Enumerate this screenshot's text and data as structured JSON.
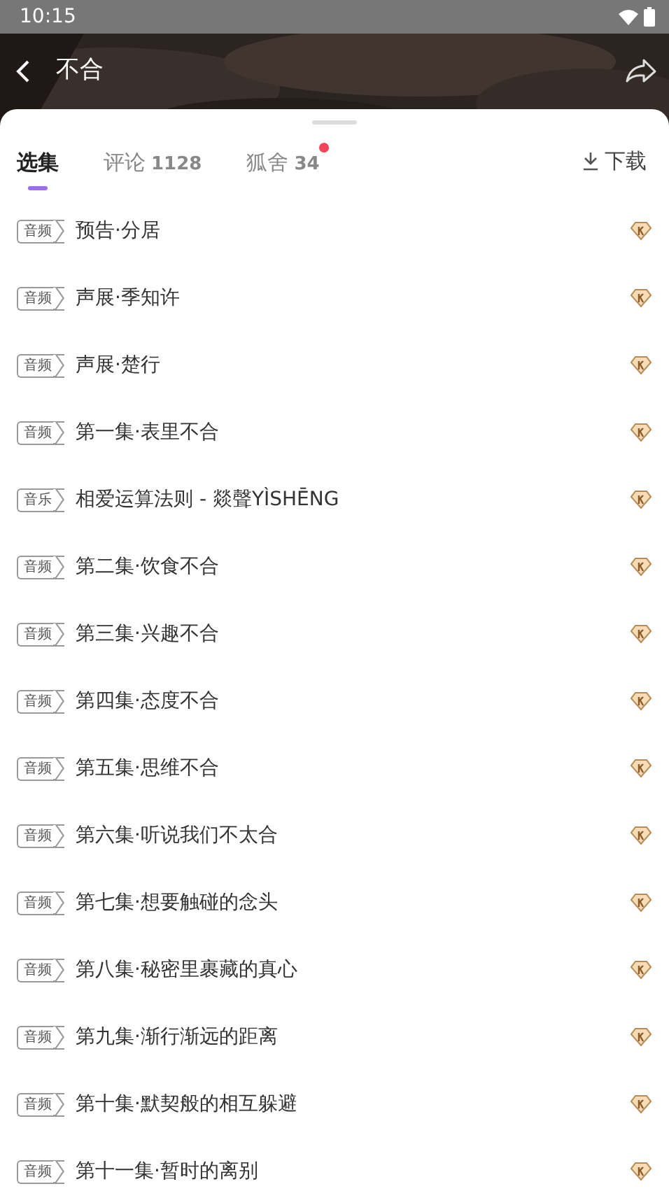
{
  "status_bar": {
    "time": "10:15"
  },
  "header": {
    "title": "不合"
  },
  "tabs": [
    {
      "label": "选集",
      "selected": true,
      "dot": false
    },
    {
      "label": "评论",
      "count": "1128",
      "selected": false,
      "dot": false
    },
    {
      "label": "狐舍",
      "count": "34",
      "selected": false,
      "dot": true
    }
  ],
  "download": {
    "label": "下载"
  },
  "episodes": [
    {
      "tag": "音频",
      "title": "预告·分居"
    },
    {
      "tag": "音频",
      "title": "声展·季知许"
    },
    {
      "tag": "音频",
      "title": "声展·楚行"
    },
    {
      "tag": "音频",
      "title": "第一集·表里不合"
    },
    {
      "tag": "音乐",
      "title": "相爱运算法则 - 燚聲YÌSHĒNG"
    },
    {
      "tag": "音频",
      "title": "第二集·饮食不合"
    },
    {
      "tag": "音频",
      "title": "第三集·兴趣不合"
    },
    {
      "tag": "音频",
      "title": "第四集·态度不合"
    },
    {
      "tag": "音频",
      "title": "第五集·思维不合"
    },
    {
      "tag": "音频",
      "title": "第六集·听说我们不太合"
    },
    {
      "tag": "音频",
      "title": "第七集·想要触碰的念头"
    },
    {
      "tag": "音频",
      "title": "第八集·秘密里裹藏的真心"
    },
    {
      "tag": "音频",
      "title": "第九集·渐行渐远的距离"
    },
    {
      "tag": "音频",
      "title": "第十集·默契般的相互躲避"
    },
    {
      "tag": "音频",
      "title": "第十一集·暂时的离别"
    }
  ]
}
